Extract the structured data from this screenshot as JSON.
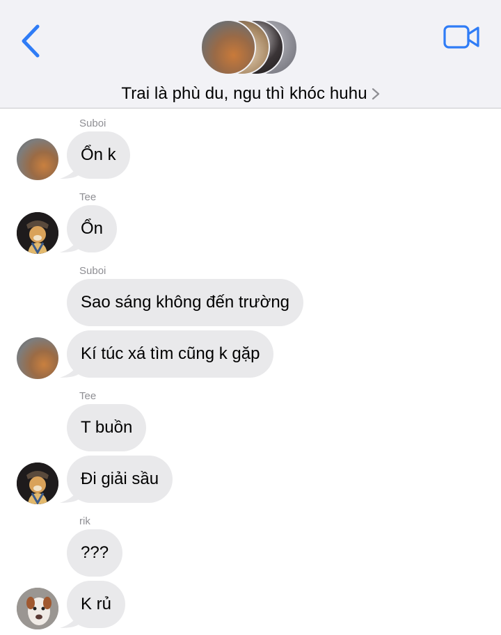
{
  "header": {
    "group_title": "Trai là phù du, ngu thì khóc huhu"
  },
  "messages": [
    {
      "sender": "Suboi",
      "text": "Ổn k",
      "avatar": "cat-avatar"
    },
    {
      "sender": "Tee",
      "text": "Ổn",
      "avatar": "cartoon-dog-avatar"
    },
    {
      "sender": "Suboi",
      "text": "Sao sáng không đến trường",
      "avatar": null
    },
    {
      "sender": "",
      "text": "Kí túc xá tìm cũng k gặp",
      "avatar": "cat-avatar"
    },
    {
      "sender": "Tee",
      "text": "T buồn",
      "avatar": null
    },
    {
      "sender": "",
      "text": "Đi giải sầu",
      "avatar": "cartoon-dog-avatar"
    },
    {
      "sender": "rik",
      "text": "???",
      "avatar": null
    },
    {
      "sender": "",
      "text": "K rủ",
      "avatar": "dog-photo-avatar"
    }
  ],
  "colors": {
    "accent": "#2f7cf6",
    "bubble": "#e9e9eb",
    "header_bg": "#f2f2f6",
    "sender_name": "#8e8e93"
  }
}
